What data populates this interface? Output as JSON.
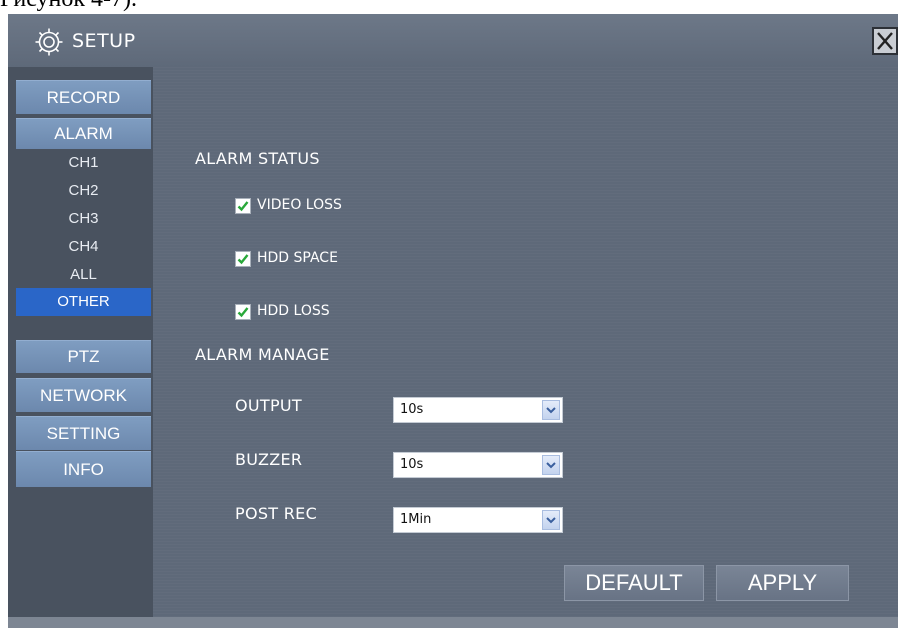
{
  "document": {
    "caption_fragment": "Рисунок 4-7)."
  },
  "window": {
    "title": "SETUP",
    "icon": "gear-icon",
    "close_icon": "close-icon"
  },
  "sidebar": {
    "items": [
      {
        "label": "RECORD"
      },
      {
        "label": "ALARM",
        "sub_items": [
          {
            "label": "CH1"
          },
          {
            "label": "CH2"
          },
          {
            "label": "CH3"
          },
          {
            "label": "CH4"
          },
          {
            "label": "ALL"
          },
          {
            "label": "OTHER",
            "selected": true
          }
        ]
      },
      {
        "label": "PTZ"
      },
      {
        "label": "NETWORK"
      },
      {
        "label": "SETTING"
      },
      {
        "label": "INFO"
      }
    ],
    "selected_color": "#2a66c8"
  },
  "alarm_status": {
    "heading": "ALARM STATUS",
    "checkboxes": [
      {
        "label": "VIDEO LOSS",
        "checked": true
      },
      {
        "label": "HDD SPACE",
        "checked": true
      },
      {
        "label": "HDD LOSS",
        "checked": true
      }
    ],
    "check_color": "#29a83a"
  },
  "alarm_manage": {
    "heading": "ALARM MANAGE",
    "fields": [
      {
        "label": "OUTPUT",
        "value": "10s"
      },
      {
        "label": "BUZZER",
        "value": "10s"
      },
      {
        "label": "POST REC",
        "value": "1Min"
      }
    ]
  },
  "buttons": {
    "default_label": "DEFAULT",
    "apply_label": "APPLY"
  }
}
